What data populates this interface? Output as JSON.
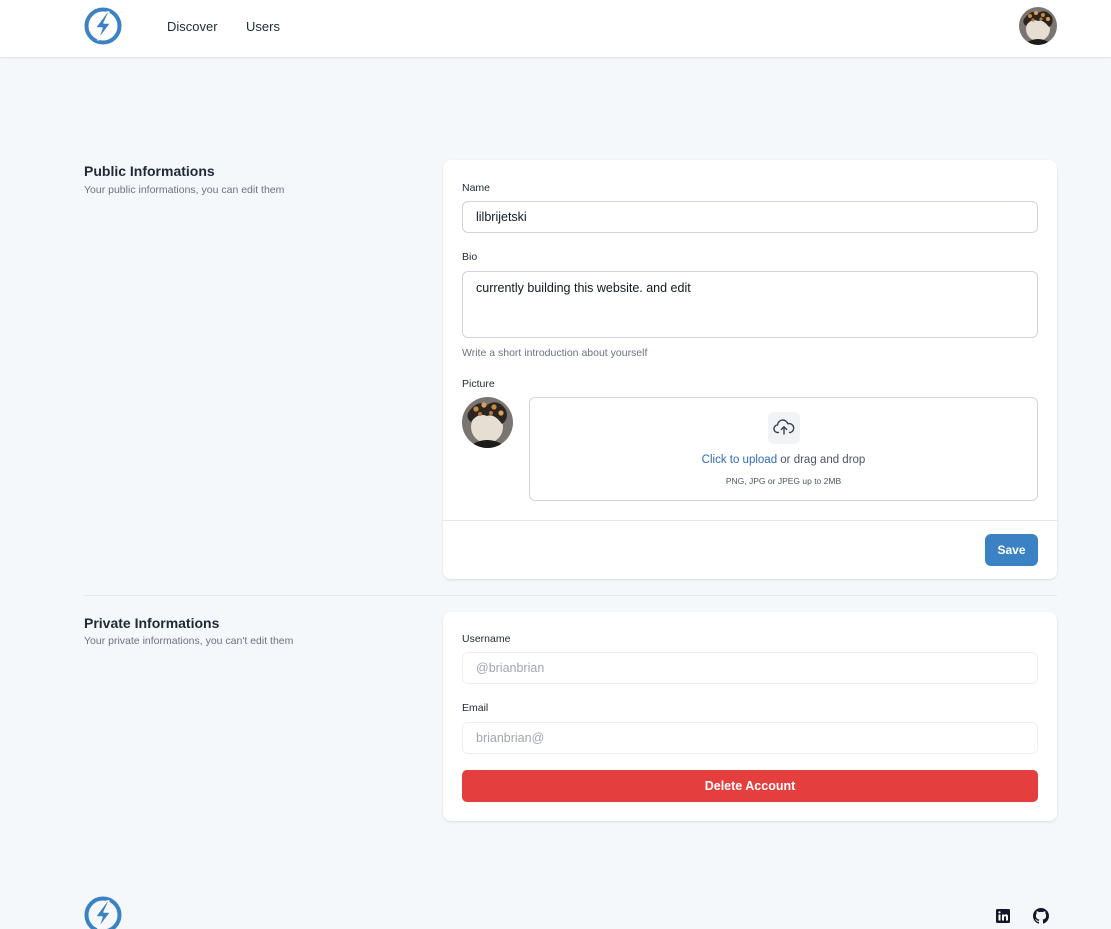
{
  "colors": {
    "page_bg": "#f5f8fb",
    "brand_blue": "#3b82c4",
    "danger_red": "#e53e3e",
    "link_blue": "#2f6db5"
  },
  "header": {
    "logo_icon": "lightning-bolt-circle-icon",
    "nav": [
      {
        "label": "Discover"
      },
      {
        "label": "Users"
      }
    ],
    "avatar_icon": "user-avatar"
  },
  "public_section": {
    "title": "Public Informations",
    "subtitle": "Your public informations, you can edit them",
    "name_label": "Name",
    "name_value": "lilbrijetski",
    "bio_label": "Bio",
    "bio_value": "currently building this website. and edit",
    "bio_hint": "Write a short introduction about yourself",
    "picture_label": "Picture",
    "upload_icon": "cloud-upload-icon",
    "upload_link": "Click to upload",
    "upload_rest": " or drag and drop",
    "upload_note": "PNG, JPG or JPEG up to 2MB",
    "save_label": "Save"
  },
  "private_section": {
    "title": "Private Informations",
    "subtitle": "Your private informations, you can't edit them",
    "username_label": "Username",
    "username_value": "@brianbrian",
    "email_label": "Email",
    "email_value": "brianbrian@",
    "delete_label": "Delete Account"
  },
  "footer": {
    "logo_icon": "lightning-bolt-circle-icon",
    "social_icons": [
      "linkedin-icon",
      "github-icon"
    ]
  }
}
